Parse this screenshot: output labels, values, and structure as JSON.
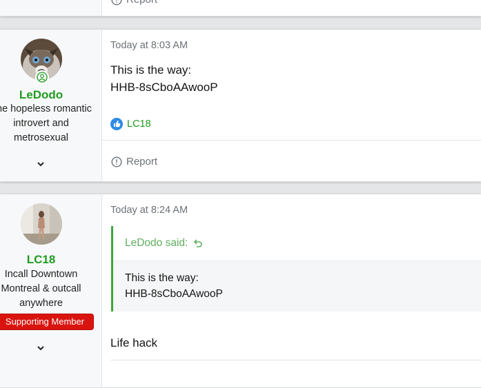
{
  "post0": {
    "report_label": "Report"
  },
  "post1": {
    "username": "LeDodo",
    "user_title": "The hopeless romantic introvert and metrosexual",
    "date": "Today at 8:03 AM",
    "message_lines": [
      "This is the way:",
      "HHB-8sCboAAwooP"
    ],
    "reaction_user": "LC18",
    "report_label": "Report"
  },
  "post2": {
    "username": "LC18",
    "user_title": "Incall Downtown Montreal & outcall anywhere",
    "banner": "Supporting Member",
    "date": "Today at 8:24 AM",
    "quote_author": "LeDodo said:",
    "quote_lines": [
      "This is the way:",
      "HHB-8sCboAAwooP"
    ],
    "message": "Life hack"
  },
  "colors": {
    "username_green": "#1f9b1f",
    "banner_red": "#d9140f",
    "quote_border": "#3da63d",
    "muted_text": "#6b7178"
  },
  "icons": {
    "report": "alert-circle-icon",
    "reaction": "like-thumb-icon",
    "online": "online-status-icon",
    "expand": "chevron-down-icon",
    "quote_jump": "return-arrow-icon"
  }
}
